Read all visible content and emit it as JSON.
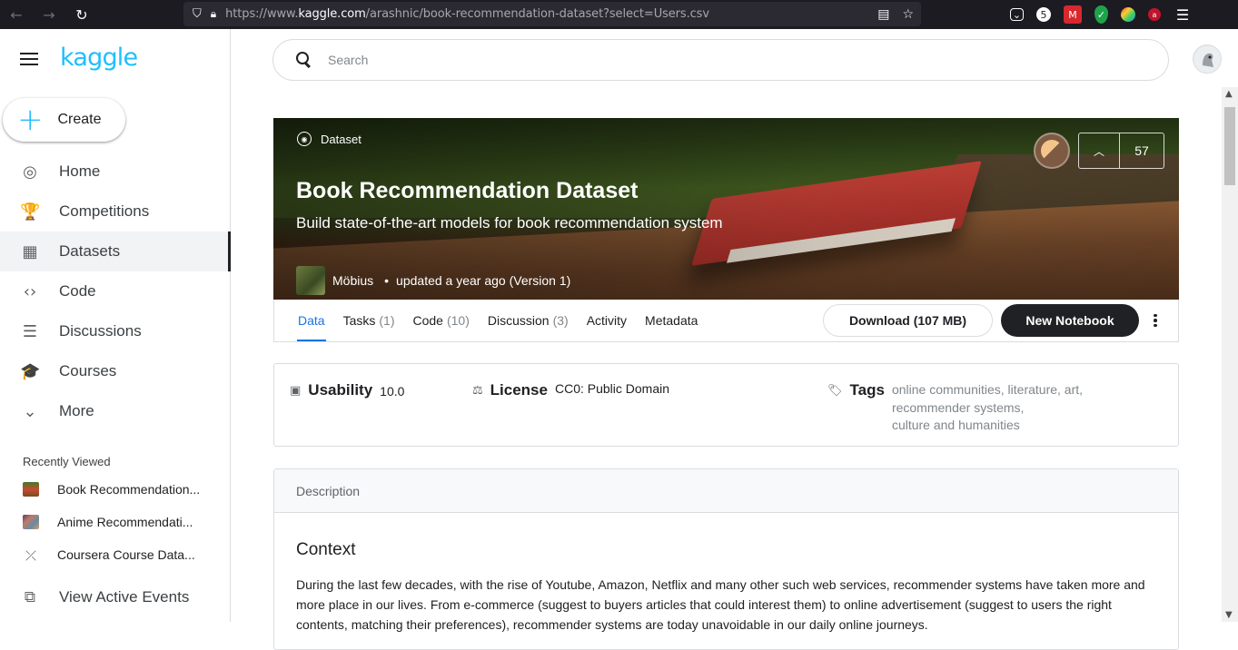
{
  "browser": {
    "url_prefix": "https://www.",
    "url_domain": "kaggle.com",
    "url_path": "/arashnic/book-recommendation-dataset?select=Users.csv",
    "ext_badge": "5"
  },
  "sidebar": {
    "logo": "kaggle",
    "create_label": "Create",
    "nav_items": [
      {
        "label": "Home",
        "icon": "◎"
      },
      {
        "label": "Competitions",
        "icon": "🏆"
      },
      {
        "label": "Datasets",
        "icon": "▦"
      },
      {
        "label": "Code",
        "icon": "‹›"
      },
      {
        "label": "Discussions",
        "icon": "☰"
      },
      {
        "label": "Courses",
        "icon": "🎓"
      },
      {
        "label": "More",
        "icon": "⌄"
      }
    ],
    "recently_viewed_title": "Recently Viewed",
    "recent_items": [
      {
        "label": "Book Recommendation...",
        "color": "#c84b2f"
      },
      {
        "label": "Anime Recommendati...",
        "color": "#7a5a8a"
      },
      {
        "label": "Coursera Course Data...",
        "color": "#ffffff"
      }
    ],
    "events_label": "View Active Events"
  },
  "search": {
    "placeholder": "Search"
  },
  "hero": {
    "type_label": "Dataset",
    "title": "Book Recommendation Dataset",
    "subtitle": "Build state-of-the-art models for book recommendation system",
    "author": "Möbius",
    "updated": "updated a year ago (Version 1)",
    "votes": "57"
  },
  "tabs": [
    {
      "label": "Data",
      "count": ""
    },
    {
      "label": "Tasks",
      "count": "(1)"
    },
    {
      "label": "Code",
      "count": "(10)"
    },
    {
      "label": "Discussion",
      "count": "(3)"
    },
    {
      "label": "Activity",
      "count": ""
    },
    {
      "label": "Metadata",
      "count": ""
    }
  ],
  "actions": {
    "download": "Download (107 MB)",
    "new_notebook": "New Notebook"
  },
  "meta": {
    "usability_label": "Usability",
    "usability_value": "10.0",
    "license_label": "License",
    "license_value": "CC0: Public Domain",
    "tags_label": "Tags",
    "tags_line1": "online communities, literature, art,",
    "tags_line2": "recommender systems,",
    "tags_line3": "culture and humanities"
  },
  "description": {
    "header": "Description",
    "context_title": "Context",
    "body": "During the last few decades, with the rise of Youtube, Amazon, Netflix and many other such web services, recommender systems have taken more and more place in our lives. From e-commerce (suggest to buyers articles that could interest them) to online advertisement (suggest to users the right contents, matching their preferences), recommender systems are today unavoidable in our daily online journeys."
  },
  "colors": {
    "brand": "#20beff",
    "active_tab": "#1a73e8",
    "dark_button": "#202124"
  }
}
